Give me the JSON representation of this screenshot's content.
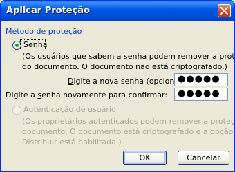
{
  "window": {
    "title": "Aplicar Proteção"
  },
  "group": {
    "label": "Método de proteção"
  },
  "options": {
    "password": {
      "label_pre": "Sen",
      "label_key": "h",
      "label_post": "a",
      "selected": true,
      "desc_line1": "(Os usuários que sabem a senha podem remover a proteção",
      "desc_line2": "do documento. O documento não está criptografado.)"
    },
    "user_auth": {
      "label": "Autenticação de usuário",
      "enabled": false,
      "desc_line1": "(Os proprietários autenticados podem remover a proteção do",
      "desc_line2": "documento. O documento está criptografado e a opção Não",
      "desc_line3": "Distribuir está habilitada.)"
    }
  },
  "fields": {
    "new_password": {
      "label_key": "D",
      "label_rest": "igite a nova senha (opcional):",
      "value": "●●●●●"
    },
    "confirm_password": {
      "label_pre": "Digite a ",
      "label_key": "s",
      "label_post": "enha novamente para confirmar:",
      "value": "●●●●●"
    }
  },
  "buttons": {
    "ok": "OK",
    "cancel": "Cancelar"
  }
}
